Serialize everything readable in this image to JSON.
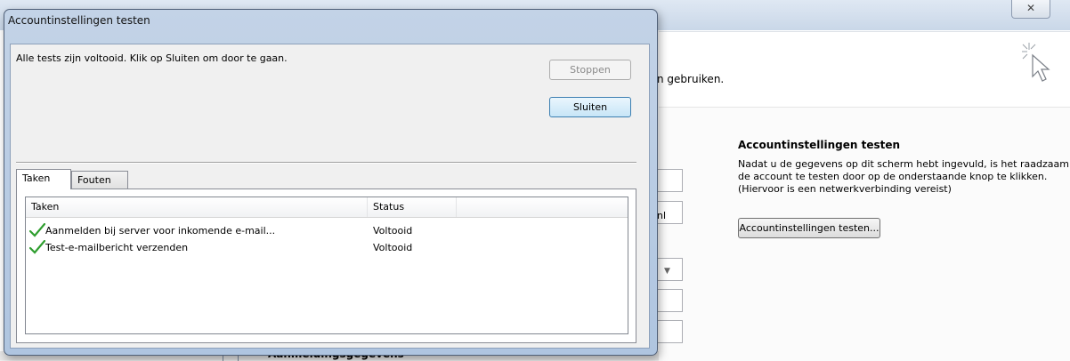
{
  "background_window": {
    "close_glyph": "✕",
    "intro_text_fragment": "n gebruiken.",
    "test_section": {
      "heading": "Accountinstellingen testen",
      "description": "Nadat u de gegevens op dit scherm hebt ingevuld, is het raadzaam de account te testen door op de onderstaande knop te klikken. (Hiervoor is een netwerkverbinding vereist)",
      "button_label": "Accountinstellingen testen..."
    },
    "field_fragment": "nl",
    "login_heading": "Aanmeldingsgegevens"
  },
  "dialog": {
    "title": "Accountinstellingen testen",
    "message": "Alle tests zijn voltooid. Klik op Sluiten om door te gaan.",
    "stop_label": "Stoppen",
    "close_label": "Sluiten",
    "tabs": [
      {
        "label": "Taken"
      },
      {
        "label": "Fouten"
      }
    ],
    "list": {
      "columns": [
        "Taken",
        "Status",
        ""
      ],
      "rows": [
        {
          "task": "Aanmelden bij server voor inkomende e-mail...",
          "status": "Voltooid"
        },
        {
          "task": "Test-e-mailbericht verzenden",
          "status": "Voltooid"
        }
      ]
    }
  },
  "colors": {
    "check_green": "#2f9e2f",
    "dialog_frame": "#b5c9e2"
  }
}
